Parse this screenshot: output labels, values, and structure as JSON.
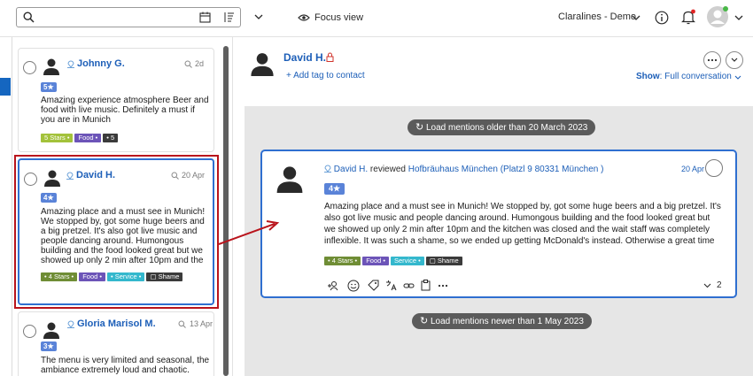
{
  "topbar": {
    "search_placeholder": "",
    "focus_label": "Focus view",
    "brand_label": "Claralines - Demo"
  },
  "colors": {
    "accent": "#1d5fb8",
    "selection_red": "#b9141c",
    "rating_blue": "#5a83d8"
  },
  "list": {
    "cards": [
      {
        "name": "Johnny G.",
        "date": "2d",
        "rating": "5★",
        "text": "Amazing experience atmosphere Beer and food with live music. Definitely a must if you are in Munich",
        "tags": [
          {
            "label": "5 Stars •",
            "color": "green"
          },
          {
            "label": "Food •",
            "color": "purple"
          },
          {
            "label": "• 5",
            "color": "dark"
          }
        ]
      },
      {
        "name": "David H.",
        "date": "20 Apr",
        "rating": "4★",
        "text": "Amazing place and a must see in Munich! We stopped by, got some huge beers and a big pretzel. It's also got live music and people dancing around. Humongous building and the food looked great but we showed up only 2 min after 10pm and the",
        "tags": [
          {
            "label": "• 4 Stars •",
            "color": "olive"
          },
          {
            "label": "Food •",
            "color": "purple"
          },
          {
            "label": "• Service •",
            "color": "teal"
          },
          {
            "label": "▢ Shame",
            "color": "dark"
          }
        ]
      },
      {
        "name": "Gloria Marisol M.",
        "date": "13 Apr",
        "rating": "3★",
        "text": "The menu is very limited and seasonal, the ambiance extremely loud and chaotic."
      }
    ]
  },
  "detail": {
    "name": "David H.",
    "add_tag": "+ Add tag to contact",
    "show_label": "Show",
    "show_value": "Full conversation",
    "load_older": "Load mentions older than 20 March 2023",
    "load_newer": "Load mentions newer than 1 May 2023",
    "mention": {
      "author": "David H.",
      "verb": "reviewed",
      "place": "Hofbräuhaus München (Platzl 9 80331 München )",
      "date": "20 Apr",
      "rating": "4★",
      "text": "Amazing place and a must see in Munich! We stopped by, got some huge beers and a big pretzel. It's also got live music and people dancing around. Humongous building and the food looked great but we showed up only 2 min after 10pm and the kitchen was closed and the wait staff was completely inflexible. It was such a shame, so we ended up getting McDonald's instead. Otherwise a great time",
      "tags": [
        {
          "label": "• 4 Stars •",
          "color": "olive"
        },
        {
          "label": "Food •",
          "color": "purple"
        },
        {
          "label": "Service •",
          "color": "teal"
        },
        {
          "label": "▢ Shame",
          "color": "dark"
        }
      ],
      "reply_count": "2"
    }
  }
}
